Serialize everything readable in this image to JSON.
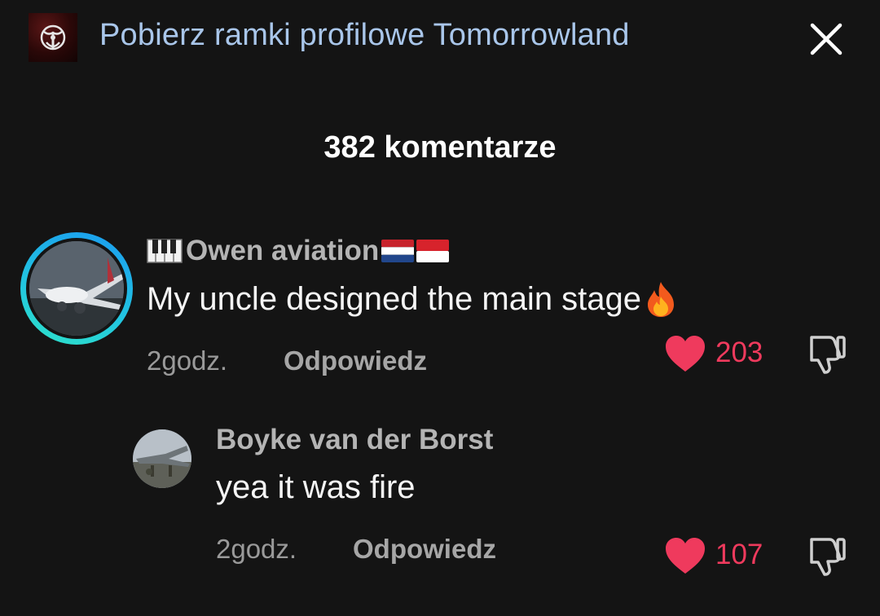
{
  "banner": {
    "title": "Pobierz ramki profilowe Tomorrowland"
  },
  "comments_header": {
    "count_label": "382 komentarze"
  },
  "comments": [
    {
      "username": "Owen aviation",
      "username_prefix_icon": "piano-keys-icon",
      "username_suffix_flags": [
        "netherlands-flag",
        "indonesia-flag"
      ],
      "text": "My uncle designed the main stage",
      "text_suffix_icon": "fire-icon",
      "time": "2godz.",
      "reply_label": "Odpowiedz",
      "likes": "203",
      "liked": true,
      "avatar": "airplane-photo",
      "avatar_ring": true
    },
    {
      "username": "Boyke van der Borst",
      "text": "yea it was fire",
      "time": "2godz.",
      "reply_label": "Odpowiedz",
      "likes": "107",
      "liked": true,
      "avatar": "fighter-jet-photo",
      "avatar_ring": false
    }
  ],
  "colors": {
    "background": "#141414",
    "banner_title": "#a9c6ea",
    "like_heart": "#ef3a5d",
    "secondary_text": "#9a9a9a"
  }
}
